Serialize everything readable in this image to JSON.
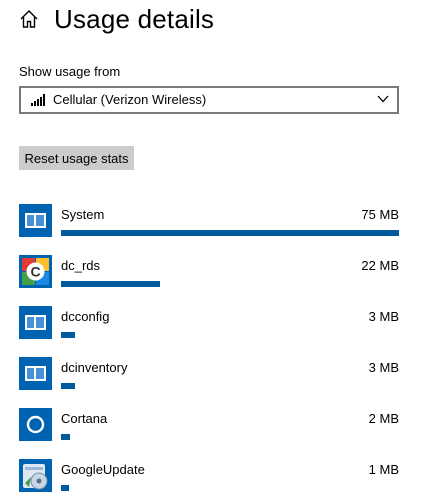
{
  "header": {
    "title": "Usage details",
    "home_icon": "home-icon"
  },
  "usage_source": {
    "label": "Show usage from",
    "selected": "Cellular (Verizon Wireless)",
    "icon": "cellular-signal-icon"
  },
  "reset_button": {
    "label": "Reset usage stats"
  },
  "accent_color": "#005a9e",
  "apps": [
    {
      "name": "System",
      "usage": "75 MB",
      "fraction": 1.0,
      "icon": "system-app-icon"
    },
    {
      "name": "dc_rds",
      "usage": "22 MB",
      "fraction": 0.293,
      "icon": "dc-rds-app-icon"
    },
    {
      "name": "dcconfig",
      "usage": "3 MB",
      "fraction": 0.04,
      "icon": "dcconfig-app-icon"
    },
    {
      "name": "dcinventory",
      "usage": "3 MB",
      "fraction": 0.04,
      "icon": "dcinventory-app-icon"
    },
    {
      "name": "Cortana",
      "usage": "2 MB",
      "fraction": 0.027,
      "icon": "cortana-app-icon"
    },
    {
      "name": "GoogleUpdate",
      "usage": "1 MB",
      "fraction": 0.013,
      "icon": "google-update-app-icon"
    }
  ]
}
